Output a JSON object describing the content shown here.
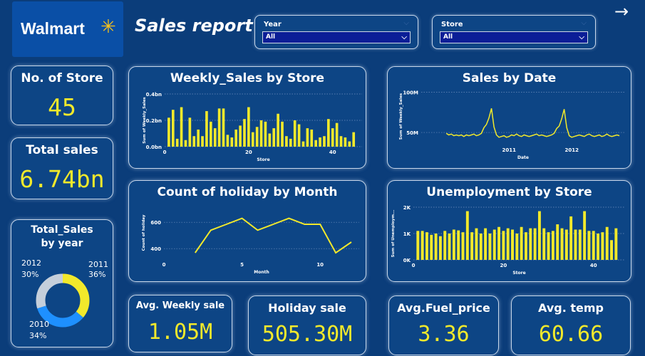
{
  "logo": {
    "text": "Walmart",
    "spark": "✳"
  },
  "report_title": "Sales report",
  "filters": [
    {
      "label": "Year",
      "value": "All"
    },
    {
      "label": "Store",
      "value": "All"
    }
  ],
  "nav": {
    "arrow_icon": "→"
  },
  "kpis": {
    "stores": {
      "title": "No. of Store",
      "value": "45"
    },
    "total_sales": {
      "title": "Total sales",
      "value": "6.74bn"
    },
    "avg_weekly": {
      "title": "Avg. Weekly sale",
      "value": "1.05M"
    },
    "holiday": {
      "title": "Holiday sale",
      "value": "505.30M"
    },
    "fuel": {
      "title": "Avg.Fuel_price",
      "value": "3.36"
    },
    "temp": {
      "title": "Avg. temp",
      "value": "60.66"
    }
  },
  "colors": {
    "background": "#0b3d7a",
    "card": "#0d4585",
    "accent": "#f2e92b",
    "donut_2010": "#1e90ff",
    "donut_2012": "#c5cfdb"
  },
  "chart_data": [
    {
      "id": "weekly_sales_by_store",
      "type": "bar",
      "title": "Weekly_Sales by Store",
      "xlabel": "Store",
      "ylabel": "Sum of Weekly_Sales",
      "ytick_labels": [
        "0.0bn",
        "0.2bn",
        "0.4bn"
      ],
      "xtick_labels": [
        "0",
        "20",
        "40"
      ],
      "ylim": [
        0,
        0.4
      ],
      "xlim": [
        0,
        47
      ],
      "x": [
        1,
        2,
        3,
        4,
        5,
        6,
        7,
        8,
        9,
        10,
        11,
        12,
        13,
        14,
        15,
        16,
        17,
        18,
        19,
        20,
        21,
        22,
        23,
        24,
        25,
        26,
        27,
        28,
        29,
        30,
        31,
        32,
        33,
        34,
        35,
        36,
        37,
        38,
        39,
        40,
        41,
        42,
        43,
        44,
        45
      ],
      "values": [
        0.22,
        0.28,
        0.06,
        0.3,
        0.05,
        0.22,
        0.08,
        0.13,
        0.08,
        0.27,
        0.19,
        0.14,
        0.29,
        0.29,
        0.09,
        0.07,
        0.13,
        0.16,
        0.21,
        0.3,
        0.11,
        0.15,
        0.2,
        0.19,
        0.1,
        0.14,
        0.25,
        0.19,
        0.08,
        0.06,
        0.2,
        0.17,
        0.04,
        0.14,
        0.13,
        0.05,
        0.07,
        0.08,
        0.21,
        0.14,
        0.18,
        0.08,
        0.07,
        0.04,
        0.11
      ]
    },
    {
      "id": "sales_by_date",
      "type": "line",
      "title": "Sales by Date",
      "xlabel": "Date",
      "ylabel": "Sum of Weekly_Sales",
      "ytick_labels": [
        "50M",
        "100M"
      ],
      "xtick_labels": [
        "2011",
        "2012"
      ],
      "ylim": [
        35,
        105
      ],
      "x": [
        0,
        0.04,
        0.08,
        0.12,
        0.16,
        0.2,
        0.24,
        0.28,
        0.32,
        0.36,
        0.4,
        0.44,
        0.48,
        0.52,
        0.56,
        0.6,
        0.64,
        0.68,
        0.72,
        0.76,
        0.8,
        0.84,
        0.88,
        0.92,
        0.96,
        1.0,
        1.04,
        1.08,
        1.12,
        1.16,
        1.2,
        1.24,
        1.28,
        1.32,
        1.36,
        1.4,
        1.44,
        1.48,
        1.52,
        1.56,
        1.6,
        1.64,
        1.68,
        1.72,
        1.76,
        1.8,
        1.84,
        1.88,
        1.92,
        1.96,
        2.0,
        2.04,
        2.08,
        2.12,
        2.16,
        2.2,
        2.24,
        2.28,
        2.32,
        2.36,
        2.4,
        2.44,
        2.48,
        2.52,
        2.56,
        2.6,
        2.64,
        2.68,
        2.72,
        2.76
      ],
      "values": [
        49,
        47,
        48,
        46,
        47,
        46,
        47,
        45,
        47,
        46,
        47,
        48,
        46,
        47,
        49,
        56,
        60,
        68,
        80,
        57,
        47,
        44,
        45,
        46,
        44,
        45,
        47,
        46,
        48,
        46,
        45,
        47,
        46,
        45,
        46,
        47,
        48,
        46,
        47,
        46,
        45,
        46,
        47,
        49,
        55,
        58,
        67,
        79,
        56,
        46,
        44,
        45,
        46,
        47,
        46,
        45,
        47,
        48,
        46,
        45,
        46,
        47,
        45,
        46,
        48,
        46,
        45,
        46,
        47,
        46
      ]
    },
    {
      "id": "holiday_by_month",
      "type": "line",
      "title": "Count of holiday by Month",
      "xlabel": "Month",
      "ylabel": "Count of holiday",
      "ytick_labels": [
        "400",
        "600"
      ],
      "xtick_labels": [
        "0",
        "5",
        "10"
      ],
      "ylim": [
        320,
        720
      ],
      "xlim": [
        0,
        12.5
      ],
      "x": [
        2,
        3,
        4,
        5,
        6,
        7,
        8,
        9,
        10,
        11,
        12
      ],
      "values": [
        368,
        540,
        585,
        630,
        540,
        585,
        630,
        585,
        585,
        368,
        450
      ]
    },
    {
      "id": "unemployment_by_store",
      "type": "bar",
      "title": "Unemployment by Store",
      "xlabel": "Store",
      "ylabel": "Sum of Unemploym...",
      "ytick_labels": [
        "0K",
        "1K",
        "2K"
      ],
      "xtick_labels": [
        "0",
        "20",
        "40"
      ],
      "ylim": [
        0,
        2000
      ],
      "xlim": [
        0,
        47
      ],
      "x": [
        1,
        2,
        3,
        4,
        5,
        6,
        7,
        8,
        9,
        10,
        11,
        12,
        13,
        14,
        15,
        16,
        17,
        18,
        19,
        20,
        21,
        22,
        23,
        24,
        25,
        26,
        27,
        28,
        29,
        30,
        31,
        32,
        33,
        34,
        35,
        36,
        37,
        38,
        39,
        40,
        41,
        42,
        43,
        44,
        45
      ],
      "values": [
        1100,
        1100,
        1050,
        950,
        1000,
        900,
        1100,
        1000,
        1150,
        1120,
        1050,
        1850,
        1050,
        1200,
        1000,
        1200,
        1000,
        1150,
        1250,
        1100,
        1200,
        1150,
        1000,
        1250,
        1050,
        1200,
        1200,
        1850,
        1200,
        1050,
        1100,
        1350,
        1200,
        1150,
        1650,
        1150,
        1150,
        1850,
        1100,
        1100,
        1000,
        1050,
        1250,
        750,
        1200
      ]
    },
    {
      "id": "total_sales_by_year",
      "type": "pie",
      "title": "Total_Sales by year",
      "categories": [
        "2010",
        "2011",
        "2012"
      ],
      "values": [
        34,
        36,
        30
      ],
      "value_labels": [
        "34%",
        "36%",
        "30%"
      ]
    }
  ]
}
